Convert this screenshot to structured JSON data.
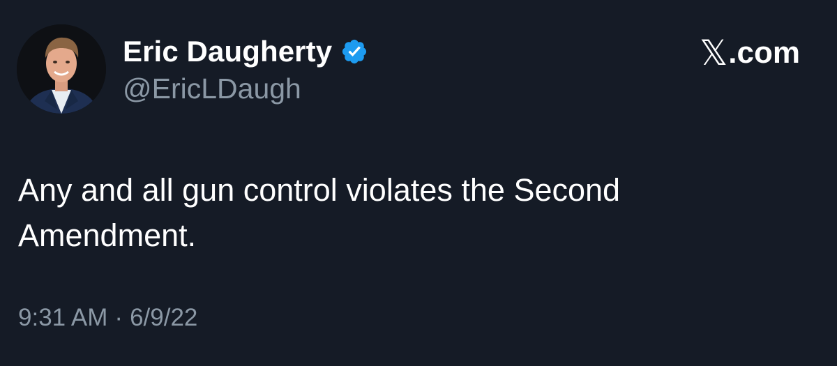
{
  "author": {
    "display_name": "Eric Daugherty",
    "handle": "@EricLDaugh",
    "verified_icon": "verified-badge-icon"
  },
  "brand": {
    "x_glyph": "𝕏",
    "domain": ".com"
  },
  "tweet": {
    "text_line1": "Any and all gun control violates the Second",
    "text_line2": "Amendment."
  },
  "meta": {
    "time": "9:31 AM",
    "separator": "·",
    "date": "6/9/22"
  },
  "colors": {
    "background": "#151b26",
    "primary_text": "#ffffff",
    "secondary_text": "#8b98a5",
    "verified_blue": "#1d9bf0"
  }
}
